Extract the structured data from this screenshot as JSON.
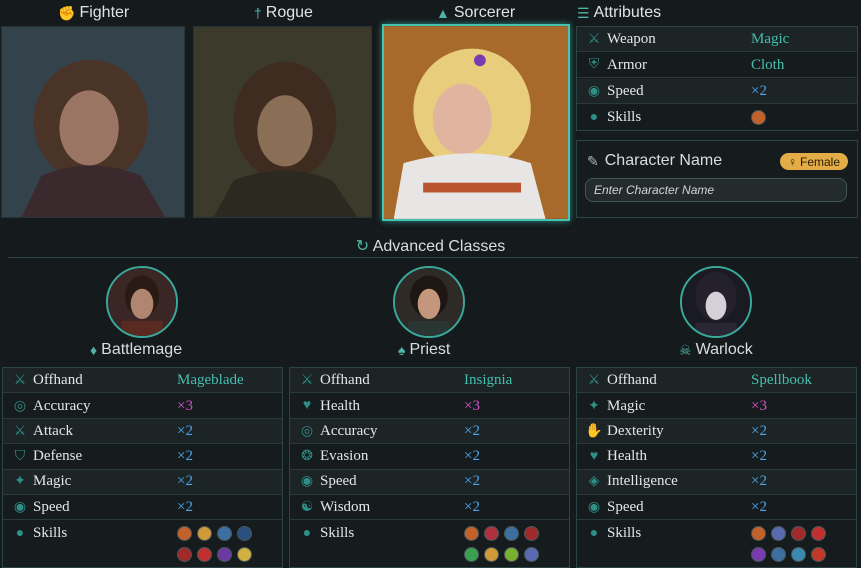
{
  "base_classes": [
    {
      "name": "Fighter",
      "icon": "fist-icon"
    },
    {
      "name": "Rogue",
      "icon": "dagger-icon"
    },
    {
      "name": "Sorcerer",
      "icon": "wizard-hat-icon",
      "selected": true
    }
  ],
  "attributes": {
    "title": "Attributes",
    "rows": [
      {
        "label": "Weapon",
        "value": "Magic",
        "icon": "weapon-icon"
      },
      {
        "label": "Armor",
        "value": "Cloth",
        "icon": "armor-icon"
      },
      {
        "label": "Speed",
        "value": "×2",
        "icon": "speed-icon"
      },
      {
        "label": "Skills",
        "value": "",
        "icon": "skills-icon"
      }
    ]
  },
  "character_name": {
    "title": "Character Name",
    "gender": "Female",
    "placeholder": "Enter Character Name",
    "value": ""
  },
  "advanced_title": "Advanced Classes",
  "advanced_classes": [
    {
      "name": "Battlemage",
      "offhand": "Mageblade",
      "rows": [
        {
          "label": "Accuracy",
          "value": "×3",
          "color": "mag"
        },
        {
          "label": "Attack",
          "value": "×2",
          "color": "blue"
        },
        {
          "label": "Defense",
          "value": "×2",
          "color": "blue"
        },
        {
          "label": "Magic",
          "value": "×2",
          "color": "blue"
        },
        {
          "label": "Speed",
          "value": "×2",
          "color": "blue"
        }
      ],
      "skills_count": 8
    },
    {
      "name": "Priest",
      "offhand": "Insignia",
      "rows": [
        {
          "label": "Health",
          "value": "×3",
          "color": "mag"
        },
        {
          "label": "Accuracy",
          "value": "×2",
          "color": "blue"
        },
        {
          "label": "Evasion",
          "value": "×2",
          "color": "blue"
        },
        {
          "label": "Speed",
          "value": "×2",
          "color": "blue"
        },
        {
          "label": "Wisdom",
          "value": "×2",
          "color": "blue"
        }
      ],
      "skills_count": 8
    },
    {
      "name": "Warlock",
      "offhand": "Spellbook",
      "rows": [
        {
          "label": "Magic",
          "value": "×3",
          "color": "mag"
        },
        {
          "label": "Dexterity",
          "value": "×2",
          "color": "blue"
        },
        {
          "label": "Health",
          "value": "×2",
          "color": "blue"
        },
        {
          "label": "Intelligence",
          "value": "×2",
          "color": "blue"
        },
        {
          "label": "Speed",
          "value": "×2",
          "color": "blue"
        }
      ],
      "skills_count": 8
    }
  ],
  "labels": {
    "offhand": "Offhand",
    "skills": "Skills"
  },
  "colors": {
    "accent": "#45bfae",
    "multiplier_high": "#d053c8",
    "multiplier": "#4fa3e8",
    "gender_badge": "#e3ac46"
  }
}
